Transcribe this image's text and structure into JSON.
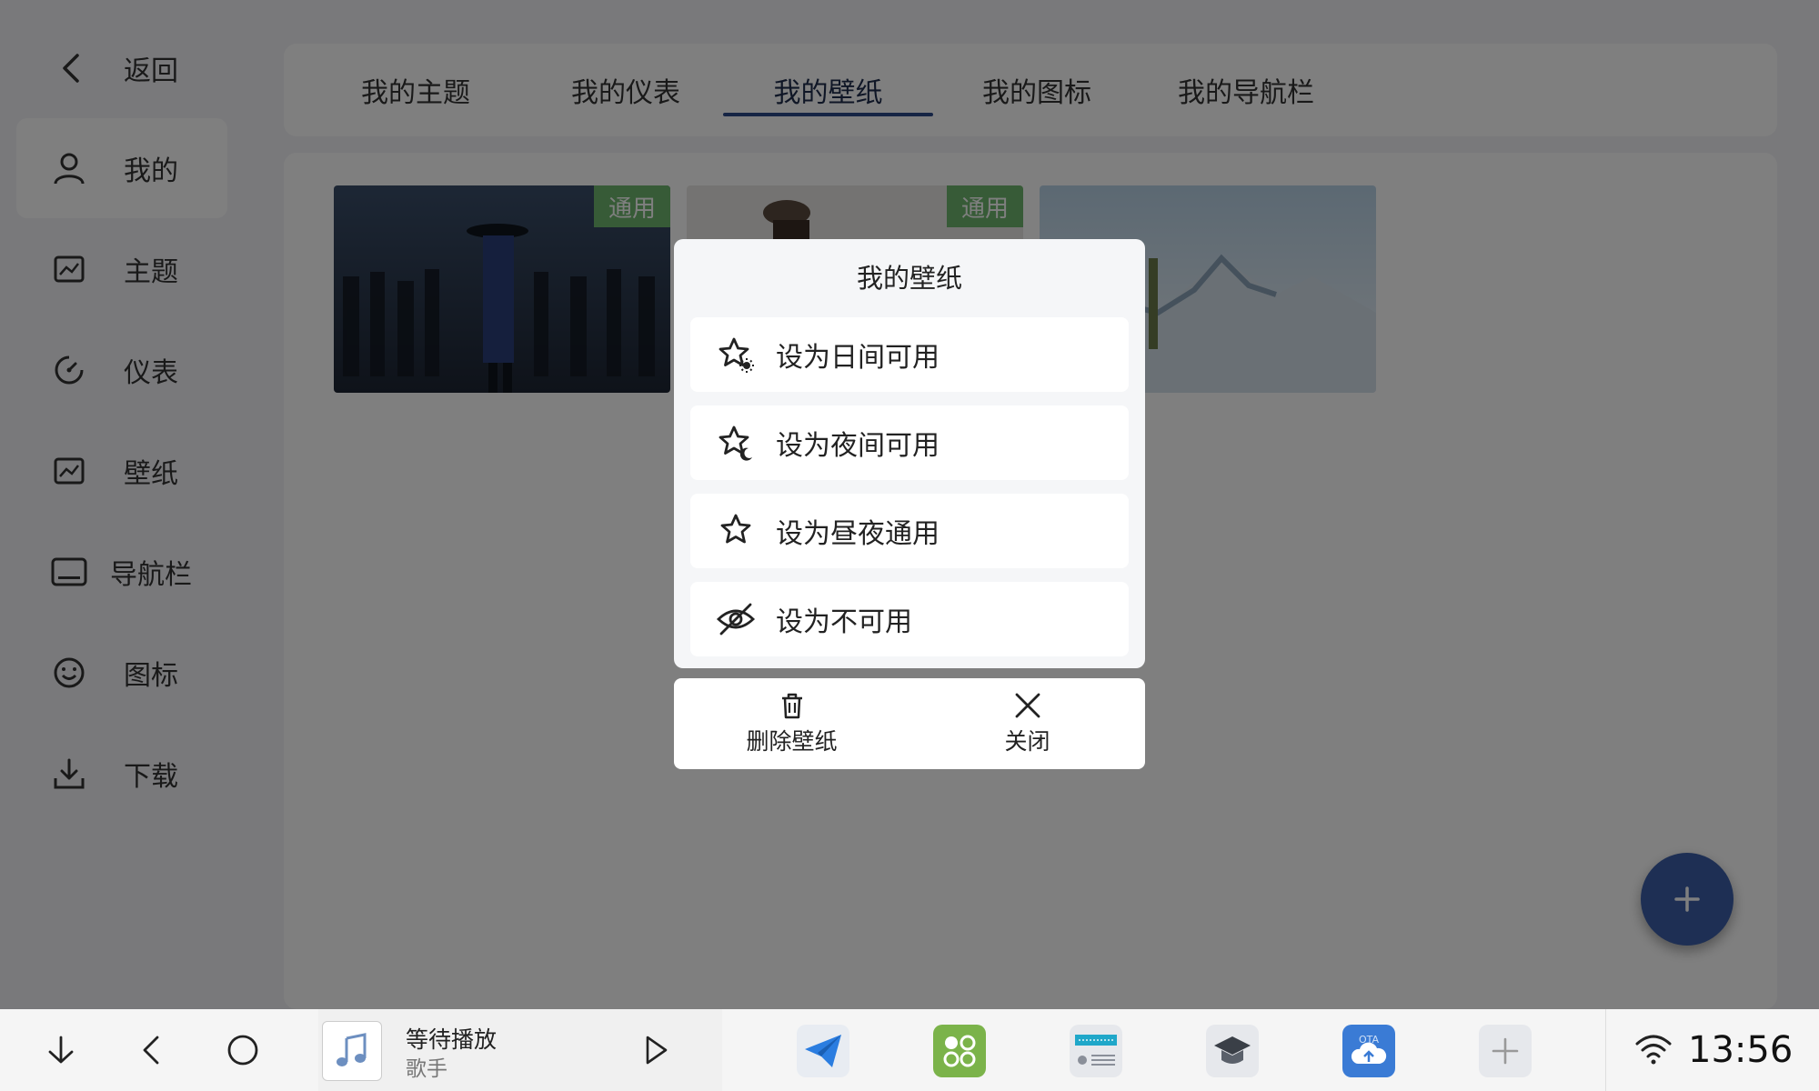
{
  "sidebar": {
    "back_label": "返回",
    "items": [
      {
        "label": "我的",
        "icon": "user-icon"
      },
      {
        "label": "主题",
        "icon": "image-icon"
      },
      {
        "label": "仪表",
        "icon": "gauge-icon"
      },
      {
        "label": "壁纸",
        "icon": "image-icon"
      },
      {
        "label": "导航栏",
        "icon": "navbar-icon"
      },
      {
        "label": "图标",
        "icon": "smiley-icon"
      },
      {
        "label": "下载",
        "icon": "download-icon"
      }
    ]
  },
  "tabs": [
    {
      "label": "我的主题"
    },
    {
      "label": "我的仪表"
    },
    {
      "label": "我的壁纸"
    },
    {
      "label": "我的图标"
    },
    {
      "label": "我的导航栏"
    }
  ],
  "active_tab": "我的壁纸",
  "wallpapers": [
    {
      "badge": "通用"
    },
    {
      "badge": "通用"
    },
    {
      "badge": ""
    }
  ],
  "dialog": {
    "title": "我的壁纸",
    "options": [
      {
        "label": "设为日间可用",
        "icon": "star-sun-icon"
      },
      {
        "label": "设为夜间可用",
        "icon": "star-moon-icon"
      },
      {
        "label": "设为昼夜通用",
        "icon": "star-icon"
      },
      {
        "label": "设为不可用",
        "icon": "eye-off-icon"
      }
    ],
    "delete_label": "删除壁纸",
    "close_label": "关闭"
  },
  "taskbar": {
    "media_status": "等待播放",
    "media_artist": "歌手",
    "time": "13:56"
  },
  "colors": {
    "accent": "#2c4a8a",
    "badge": "#6fb66f",
    "fab": "#3c5fa8"
  }
}
